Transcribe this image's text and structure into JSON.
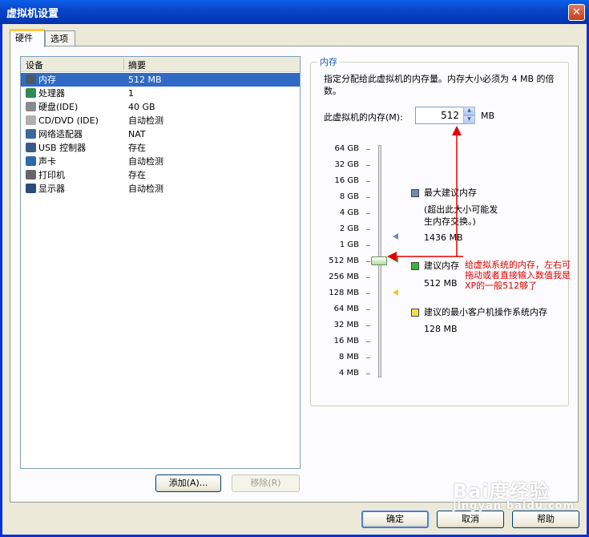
{
  "window": {
    "title": "虚拟机设置",
    "close_glyph": "✕"
  },
  "tabs": [
    {
      "label": "硬件"
    },
    {
      "label": "选项"
    }
  ],
  "devices": {
    "columns": {
      "device": "设备",
      "summary": "摘要"
    },
    "rows": [
      {
        "name": "内存",
        "summary": "512 MB",
        "icon": "memory-icon",
        "selected": true
      },
      {
        "name": "处理器",
        "summary": "1",
        "icon": "cpu-icon"
      },
      {
        "name": "硬盘(IDE)",
        "summary": "40 GB",
        "icon": "harddisk-icon"
      },
      {
        "name": "CD/DVD (IDE)",
        "summary": "自动检测",
        "icon": "cdrom-icon"
      },
      {
        "name": "网络适配器",
        "summary": "NAT",
        "icon": "network-icon"
      },
      {
        "name": "USB 控制器",
        "summary": "存在",
        "icon": "usb-icon"
      },
      {
        "name": "声卡",
        "summary": "自动检测",
        "icon": "sound-icon"
      },
      {
        "name": "打印机",
        "summary": "存在",
        "icon": "printer-icon"
      },
      {
        "name": "显示器",
        "summary": "自动检测",
        "icon": "monitor-icon"
      }
    ],
    "add_label": "添加(A)...",
    "remove_label": "移除(R)"
  },
  "memory": {
    "group_title": "内存",
    "description": "指定分配给此虚拟机的内存量。内存大小必须为 4 MB 的倍数。",
    "field_label": "此虚拟机的内存(M):",
    "value": "512",
    "unit": "MB",
    "scale": [
      "64 GB",
      "32 GB",
      "16 GB",
      "8 GB",
      "4 GB",
      "2 GB",
      "1 GB",
      "512 MB",
      "256 MB",
      "128 MB",
      "64 MB",
      "32 MB",
      "16 MB",
      "8 MB",
      "4 MB"
    ],
    "slider_level": "512 MB",
    "legend": {
      "max_title": "最大建议内存",
      "max_note": "(超出此大小可能发生内存交换。)",
      "max_value": "1436 MB",
      "rec_title": "建议内存",
      "rec_value": "512 MB",
      "min_title": "建议的最小客户机操作系统内存",
      "min_value": "128 MB"
    },
    "colors": {
      "max": "#6f88b0",
      "recommended": "#3cb43c",
      "minimum": "#f0e050",
      "annotation": "#e00000"
    }
  },
  "annotation": "给虚拟系统的内存，左右可拖动或者直接输入数值我是XP的一般512够了",
  "buttons": {
    "ok": "确定",
    "cancel": "取消",
    "help": "帮助"
  },
  "watermark": {
    "brand": "Bai度经验",
    "url": "jingyan.baidu.com"
  }
}
